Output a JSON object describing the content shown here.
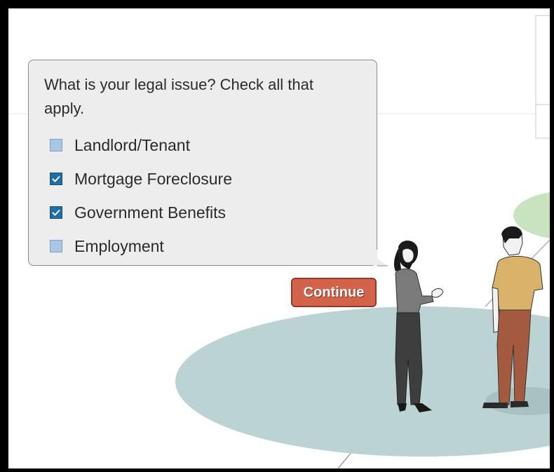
{
  "dialog": {
    "question": "What is your legal issue? Check all that apply.",
    "options": [
      {
        "label": "Landlord/Tenant",
        "checked": false
      },
      {
        "label": "Mortgage Foreclosure",
        "checked": true
      },
      {
        "label": "Government Benefits",
        "checked": true
      },
      {
        "label": "Employment",
        "checked": false
      }
    ],
    "continue_label": "Continue"
  },
  "colors": {
    "checkbox_checked": "#1f6ea8",
    "checkbox_unchecked": "#a9c6e4",
    "continue_button": "#d4634b",
    "floor_ellipse": "#bcd3d4",
    "green_ellipse": "#c9e2c0"
  }
}
